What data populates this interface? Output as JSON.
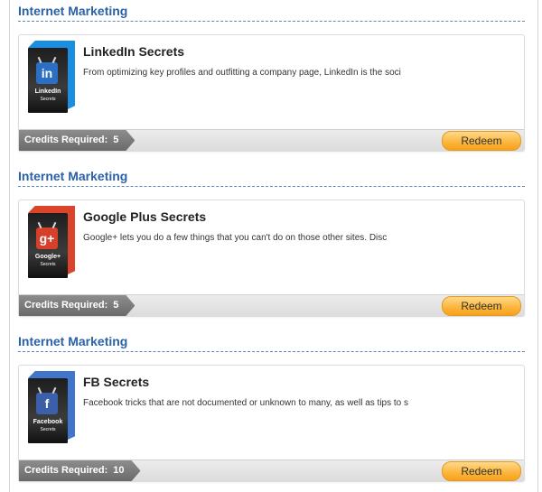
{
  "sections": [
    {
      "heading": "Internet Marketing",
      "product": {
        "title": "LinkedIn Secrets",
        "description": "From optimizing key profiles and outfitting a company page, LinkedIn is the soci",
        "box_icon": "linkedin-icon",
        "box_glyph": "in",
        "box_label": "LinkedIn",
        "box_sublabel": "Secrets",
        "accent_color": "#1a8fe0",
        "icon_color": "#2a6fc4"
      },
      "credits_label": "Credits Required:",
      "credits_value": "5",
      "redeem_label": "Redeem"
    },
    {
      "heading": "Internet Marketing",
      "product": {
        "title": "Google Plus Secrets",
        "description": "Google+ lets you do a few things that you can't do on those other sites. Disc",
        "box_icon": "google-plus-icon",
        "box_glyph": "g+",
        "box_label": "Google+",
        "box_sublabel": "Secrets",
        "accent_color": "#d9442b",
        "icon_color": "#d6402a"
      },
      "credits_label": "Credits Required:",
      "credits_value": "5",
      "redeem_label": "Redeem"
    },
    {
      "heading": "Internet Marketing",
      "product": {
        "title": "FB Secrets",
        "description": "Facebook tricks that are not documented or unknown to many, as well as tips to s",
        "box_icon": "facebook-icon",
        "box_glyph": "f",
        "box_label": "Facebook",
        "box_sublabel": "Secrets",
        "accent_color": "#3f76c9",
        "icon_color": "#3b5fa8"
      },
      "credits_label": "Credits Required:",
      "credits_value": "10",
      "redeem_label": "Redeem"
    }
  ],
  "colors": {
    "heading": "#2b62a6",
    "button": "#fbb43a",
    "credits_tag": "#7a7a7a"
  }
}
